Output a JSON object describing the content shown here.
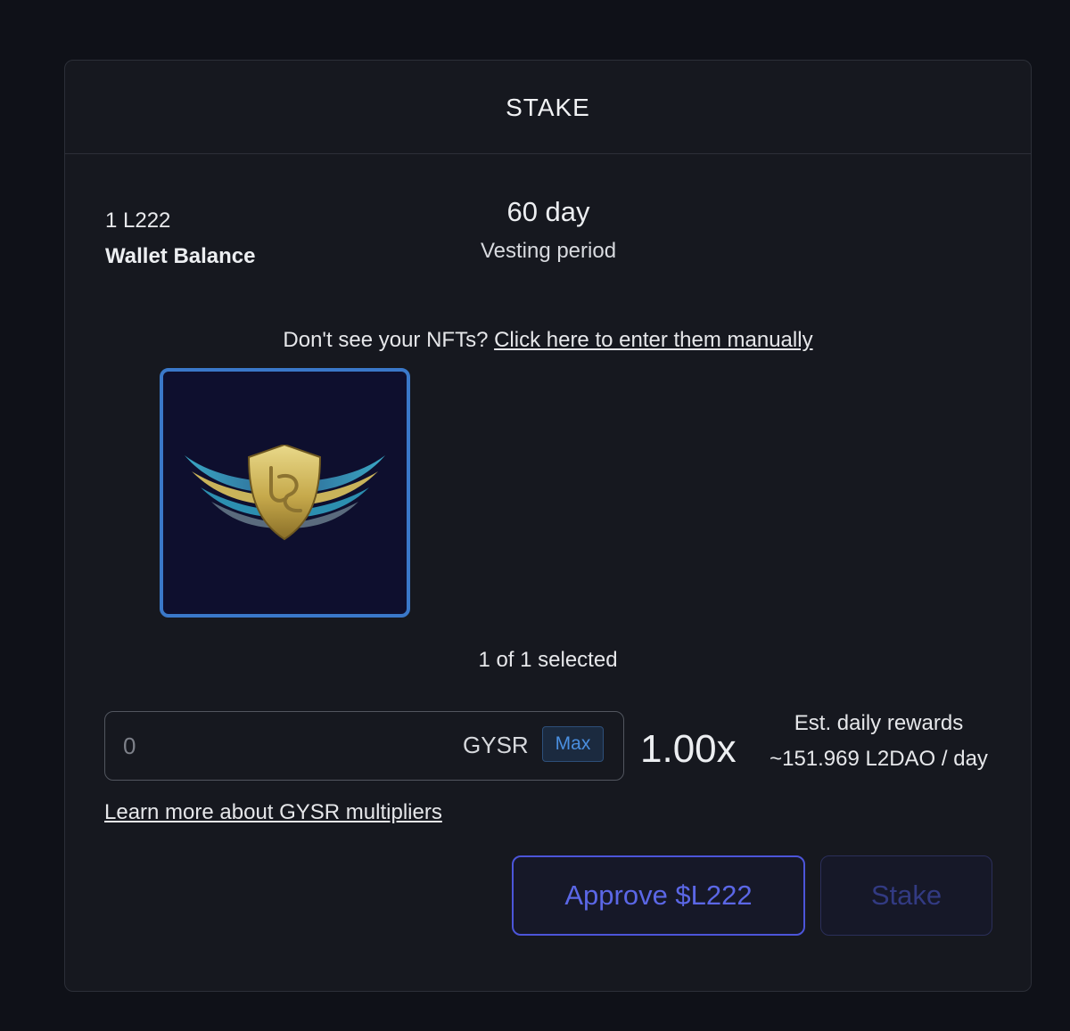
{
  "header": {
    "title": "STAKE"
  },
  "balance": {
    "amount": "1 L222",
    "label": "Wallet Balance"
  },
  "vesting": {
    "value": "60 day",
    "label": "Vesting period"
  },
  "nft_hint": {
    "prefix": "Don't see your NFTs? ",
    "link_text": "Click here to enter them manually"
  },
  "nfts": [
    {
      "selected": true,
      "image_icon": "l2dao-winged-shield-icon",
      "border_color": "#3a78c9"
    }
  ],
  "selection": {
    "text": "1 of 1 selected"
  },
  "gysr": {
    "value": "",
    "placeholder": "0",
    "unit": "GYSR",
    "max_label": "Max",
    "multiplier": "1.00x"
  },
  "rewards": {
    "label": "Est. daily rewards",
    "value": "~151.969 L2DAO / day"
  },
  "learn_more": "Learn more about GYSR multipliers",
  "actions": {
    "approve_label": "Approve $L222",
    "stake_label": "Stake",
    "stake_disabled": true
  },
  "colors": {
    "accent": "#4c55d9",
    "selection": "#3a78c9",
    "max_button": "#4a8fe0",
    "background": "#0f1118",
    "card": "#16181f"
  }
}
